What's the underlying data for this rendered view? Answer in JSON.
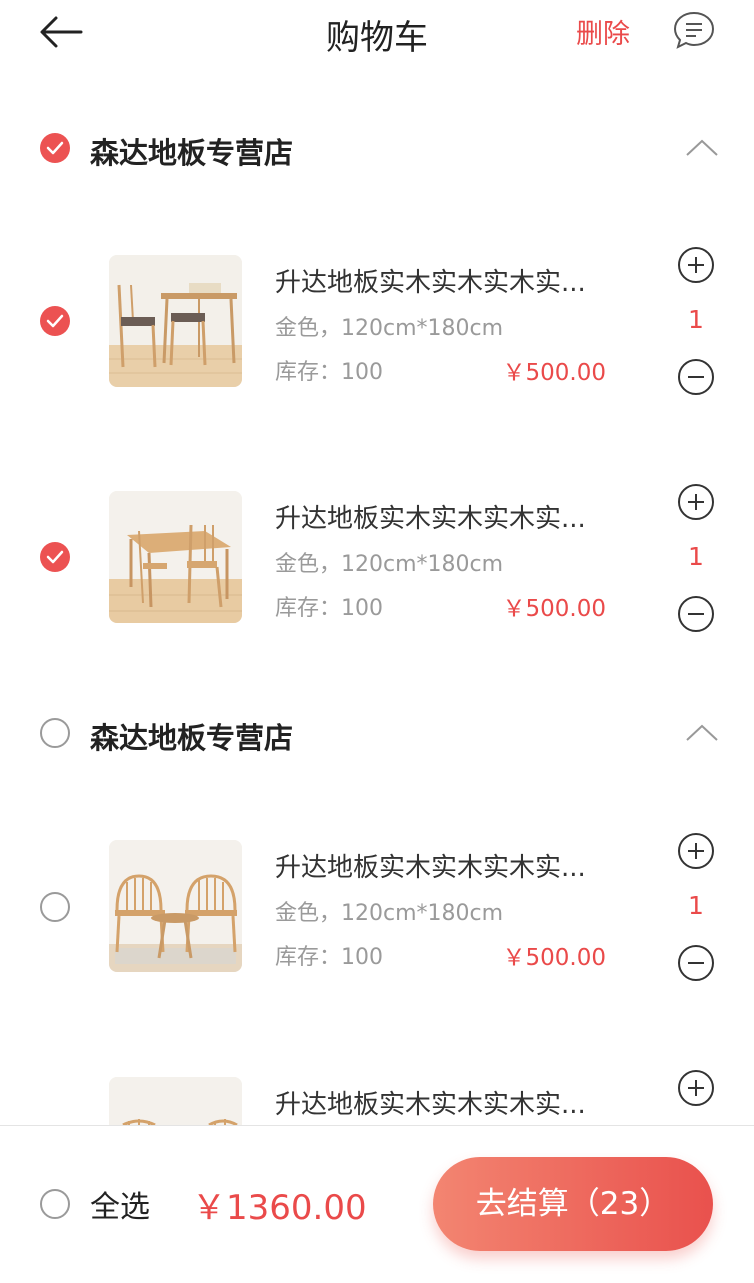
{
  "header": {
    "title": "购物车",
    "delete_label": "删除"
  },
  "shops": [
    {
      "name": "森达地板专营店",
      "checked": true,
      "items": [
        {
          "name": "升达地板实木实木实木实...",
          "spec": "金色，120cm*180cm",
          "stock": "库存：100",
          "price": "￥500.00",
          "qty": "1",
          "checked": true,
          "image": "chairs-and-table"
        },
        {
          "name": "升达地板实木实木实木实...",
          "spec": "金色，120cm*180cm",
          "stock": "库存：100",
          "price": "￥500.00",
          "qty": "1",
          "checked": true,
          "image": "dining-table-set"
        }
      ]
    },
    {
      "name": "森达地板专营店",
      "checked": false,
      "items": [
        {
          "name": "升达地板实木实木实木实...",
          "spec": "金色，120cm*180cm",
          "stock": "库存：100",
          "price": "￥500.00",
          "qty": "1",
          "checked": false,
          "image": "windsor-chairs"
        },
        {
          "name": "升达地板实木实木实木实...",
          "checked": false,
          "image": "chairs-partial"
        }
      ]
    }
  ],
  "footer": {
    "select_all_label": "全选",
    "total": "￥1360.00",
    "checkout_label": "去结算（23）"
  },
  "colors": {
    "accent": "#ea4a4a",
    "gradient_start": "#f38571",
    "gradient_end": "#e9514d"
  },
  "icons": [
    "arrow-left-icon",
    "message-icon",
    "check-icon",
    "chevron-up-icon",
    "plus-circle-icon",
    "minus-circle-icon"
  ]
}
